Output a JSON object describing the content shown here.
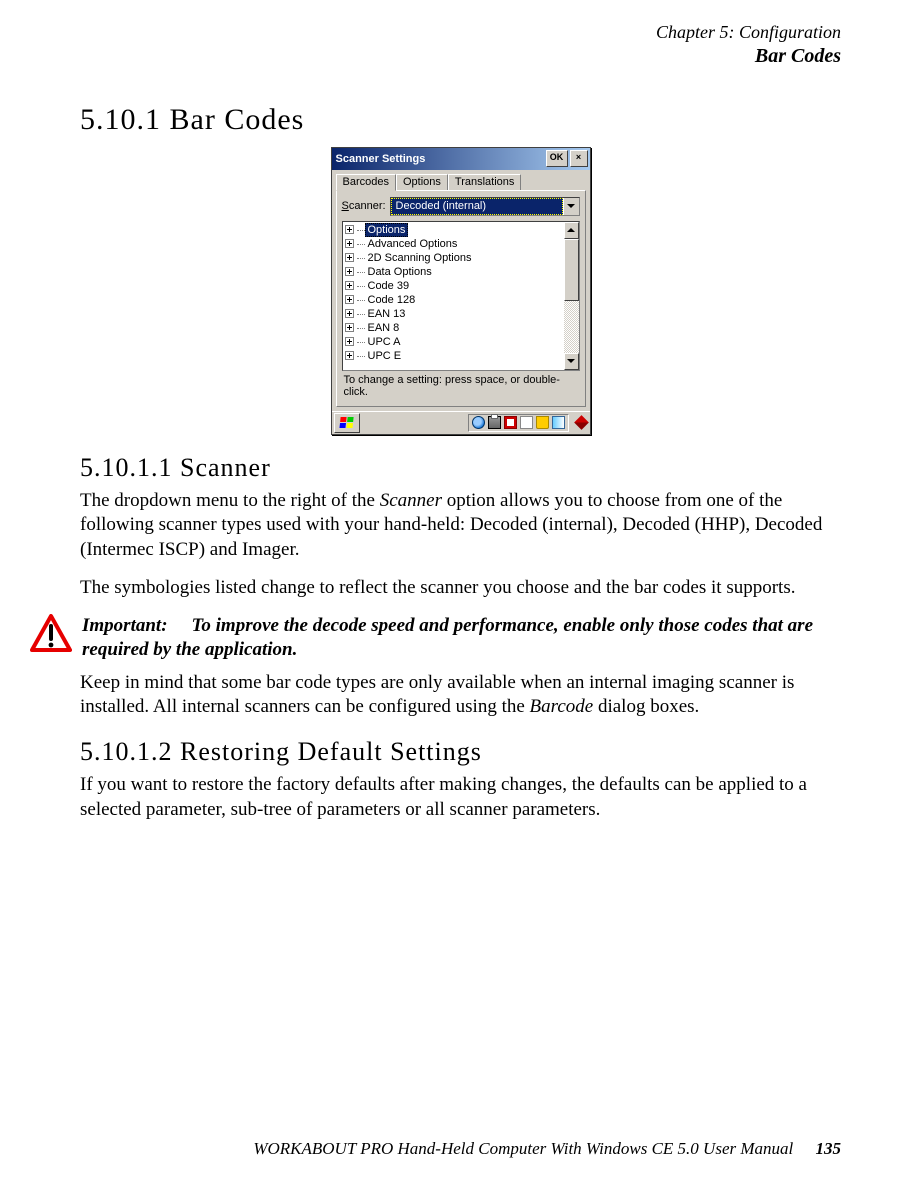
{
  "header": {
    "chapter": "Chapter 5: Configuration",
    "section": "Bar Codes"
  },
  "h_5_10_1": "5.10.1  Bar Codes",
  "h_5_10_1_1": "5.10.1.1  Scanner",
  "h_5_10_1_2": "5.10.1.2  Restoring Default Settings",
  "p1a": "The dropdown menu to the right of the ",
  "p1_em": "Scanner",
  "p1b": " option allows you to choose from one of the following scanner types used with your hand-held: Decoded (internal), Decoded (HHP), Decoded (Intermec ISCP) and Imager.",
  "p2": "The symbologies listed change to reflect the scanner you choose and the bar codes it supports.",
  "important_label": "Important:",
  "important_body": "To improve the decode speed and performance, enable only those codes that are required by the application.",
  "p3a": "Keep in mind that some bar code types are only available when an internal imaging scanner is installed. All internal scanners can be configured using the ",
  "p3_em": "Barcode",
  "p3b": " dialog boxes.",
  "p4": "If you want to restore the factory defaults after making changes, the defaults can be applied to a selected parameter, sub-tree of parameters or all scanner parameters.",
  "footer": {
    "text": "WORKABOUT PRO Hand-Held Computer With Windows CE 5.0 User Manual",
    "page": "135"
  },
  "shot": {
    "title": "Scanner Settings",
    "ok": "OK",
    "close": "×",
    "tabs": {
      "t1": "Barcodes",
      "t2": "Options",
      "t3": "Translations"
    },
    "scanner_label": "Scanner:",
    "scanner_value": "Decoded (internal)",
    "tree": {
      "i0": "Options",
      "i1": "Advanced Options",
      "i2": "2D Scanning Options",
      "i3": "Data Options",
      "i4": "Code 39",
      "i5": "Code 128",
      "i6": "EAN 13",
      "i7": "EAN 8",
      "i8": "UPC A",
      "i9": "UPC E"
    },
    "hint": "To change a setting: press space, or double-click."
  }
}
